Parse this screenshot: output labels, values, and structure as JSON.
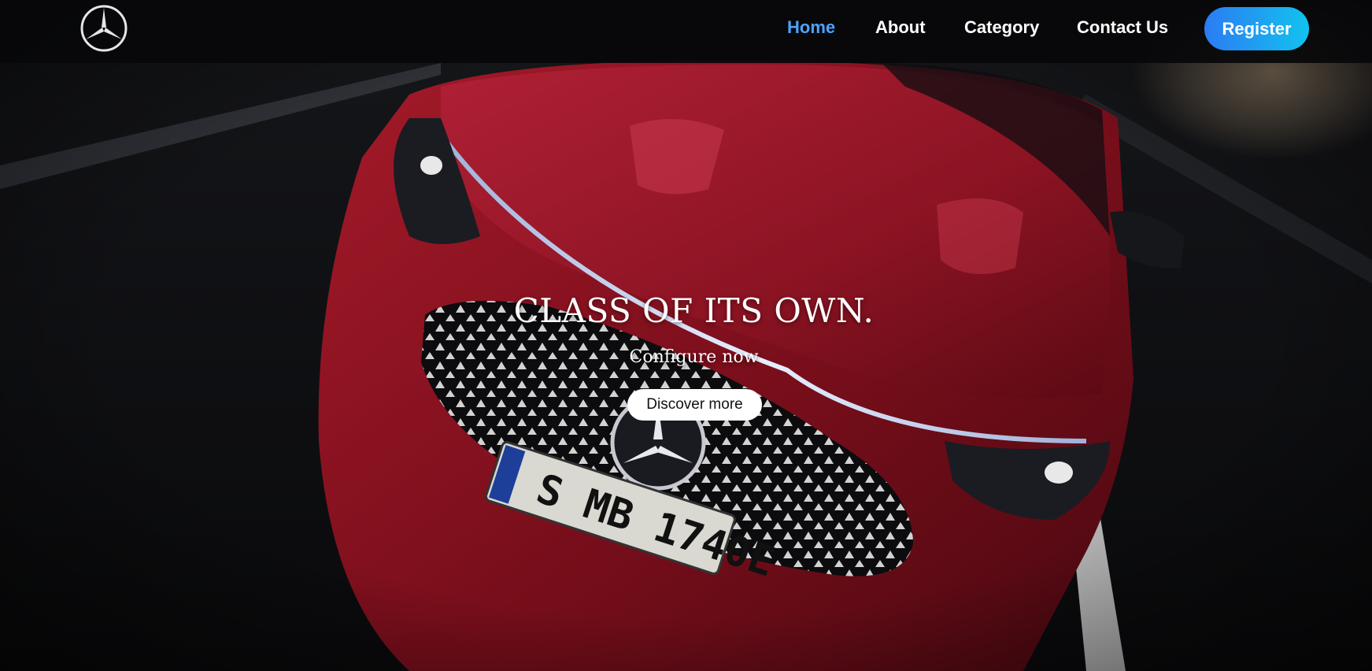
{
  "nav": {
    "logo_icon": "mercedes-star-logo",
    "links": [
      {
        "label": "Home",
        "active": true
      },
      {
        "label": "About",
        "active": false
      },
      {
        "label": "Category",
        "active": false
      },
      {
        "label": "Contact Us",
        "active": false
      }
    ],
    "register_label": "Register",
    "active_color": "#4da3ff",
    "register_gradient": [
      "#2b7cf2",
      "#12c2ef"
    ]
  },
  "hero": {
    "title": "CLASS OF ITS OWN.",
    "subtitle": "Configure now",
    "cta_label": "Discover more",
    "plate_text": "S MB 1740E",
    "plate_country": "D",
    "car_color": "#8c1320"
  }
}
